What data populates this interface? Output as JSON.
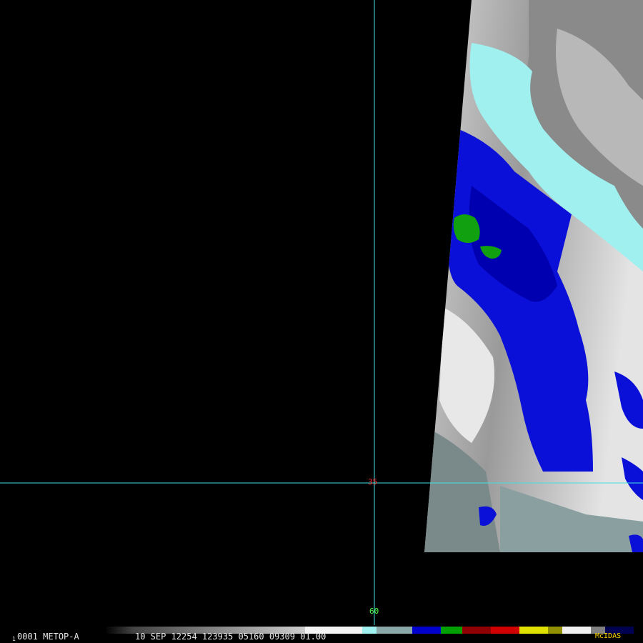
{
  "image": {
    "satellite": "METOP-A",
    "frame_number": "0001",
    "frame_marker": "1",
    "timestamp_line": "10 SEP 12254 123935 05160 09309 01.00",
    "logo": "McIDAS"
  },
  "grid": {
    "line_color": "#40e0e0",
    "latitude_labels": [
      {
        "label": "35",
        "color": "#ff3030"
      },
      {
        "label": "60",
        "color": "#50ff50"
      }
    ]
  },
  "color_enhancement": {
    "segments": [
      {
        "name": "dark-gray",
        "color": "#2a2a2a"
      },
      {
        "name": "mid-gray",
        "color": "#6a6a6a"
      },
      {
        "name": "light-gray",
        "color": "#a8a8a8"
      },
      {
        "name": "white",
        "color": "#f4f4f4"
      },
      {
        "name": "cyan",
        "color": "#a0f0f0"
      },
      {
        "name": "gray-cyan",
        "color": "#8aa8a8"
      },
      {
        "name": "blue",
        "color": "#0000cc"
      },
      {
        "name": "green",
        "color": "#00a000"
      },
      {
        "name": "dark-red",
        "color": "#900000"
      },
      {
        "name": "red",
        "color": "#d00000"
      },
      {
        "name": "yellow",
        "color": "#e0e000"
      },
      {
        "name": "olive",
        "color": "#909000"
      },
      {
        "name": "white-2",
        "color": "#f0f0f0"
      },
      {
        "name": "gray-2",
        "color": "#808080"
      },
      {
        "name": "navy",
        "color": "#000050"
      }
    ]
  }
}
